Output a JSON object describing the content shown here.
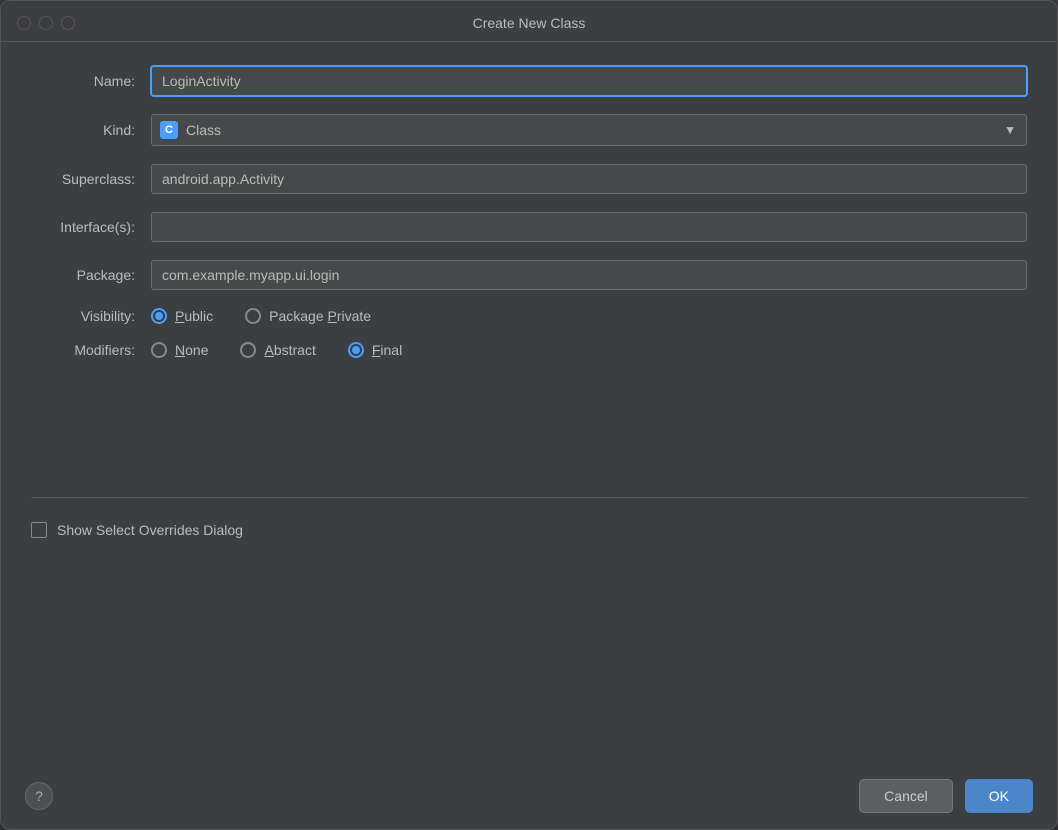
{
  "dialog": {
    "title": "Create New Class"
  },
  "traffic_lights": {
    "close_label": "close",
    "minimize_label": "minimize",
    "maximize_label": "maximize"
  },
  "form": {
    "name_label": "Name:",
    "name_value": "LoginActivity",
    "name_placeholder": "",
    "kind_label": "Kind:",
    "kind_value": "Class",
    "kind_icon_letter": "C",
    "superclass_label": "Superclass:",
    "superclass_value": "android.app.Activity",
    "interfaces_label": "Interface(s):",
    "interfaces_value": "",
    "package_label": "Package:",
    "package_value": "com.example.myapp.ui.login",
    "visibility_label": "Visibility:",
    "visibility_options": [
      {
        "id": "public",
        "label": "Public",
        "checked": true
      },
      {
        "id": "package_private",
        "label": "Package Private",
        "checked": false
      }
    ],
    "modifiers_label": "Modifiers:",
    "modifiers_options": [
      {
        "id": "none",
        "label": "None",
        "checked": false
      },
      {
        "id": "abstract",
        "label": "Abstract",
        "checked": false
      },
      {
        "id": "final",
        "label": "Final",
        "checked": true
      }
    ]
  },
  "checkbox": {
    "label": "Show Select Overrides Dialog",
    "checked": false
  },
  "footer": {
    "help_label": "?",
    "cancel_label": "Cancel",
    "ok_label": "OK"
  }
}
